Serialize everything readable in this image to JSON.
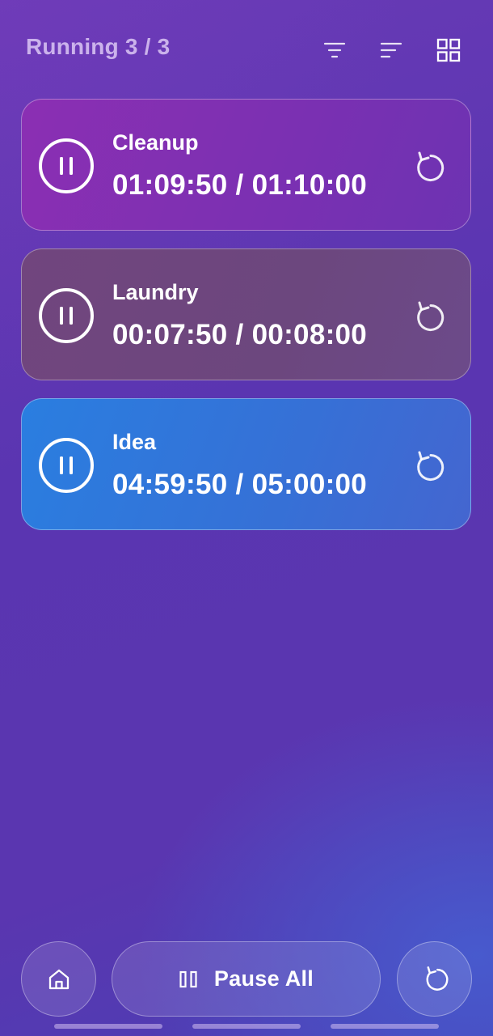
{
  "header": {
    "title": "Running 3 / 3",
    "icons": [
      "filter-icon",
      "sort-icon",
      "grid-view-icon"
    ]
  },
  "timers": [
    {
      "name": "Cleanup",
      "time": "01:09:50 / 01:10:00",
      "color": "#8b2fb3"
    },
    {
      "name": "Laundry",
      "time": "00:07:50 / 00:08:00",
      "color": "#71457e"
    },
    {
      "name": "Idea",
      "time": "04:59:50 / 05:00:00",
      "color": "#2a7ee0"
    }
  ],
  "bottom_bar": {
    "home_icon": "home-icon",
    "pause_all_label": "Pause All",
    "reset_all_icon": "reset-icon"
  },
  "colors": {
    "background": "#5a35b1",
    "accent": "#ffffff"
  }
}
